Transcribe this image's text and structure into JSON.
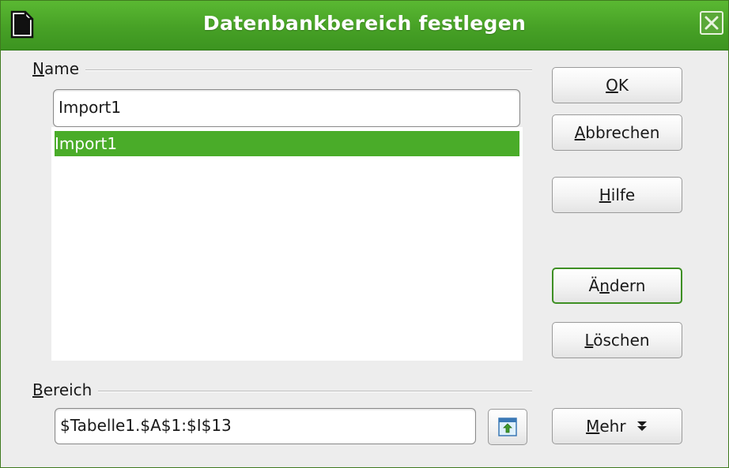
{
  "window": {
    "title": "Datenbankbereich festlegen",
    "accent_color": "#4aac29",
    "icons": {
      "app": "libreoffice-document-icon",
      "close": "close-icon"
    }
  },
  "name_section": {
    "label_mnemonic": "N",
    "label_rest": "ame",
    "input_value": "Import1",
    "list_items": [
      "Import1"
    ],
    "selected_index": 0
  },
  "range_section": {
    "label_mnemonic": "B",
    "label_rest": "ereich",
    "input_value": "$Tabelle1.$A$1:$I$13",
    "shrink_icon": "shrink-dialog-icon"
  },
  "buttons": {
    "ok": {
      "pre": "",
      "mnemonic": "O",
      "post": "K"
    },
    "cancel": {
      "pre": "",
      "mnemonic": "A",
      "post": "bbrechen"
    },
    "help": {
      "pre": "",
      "mnemonic": "H",
      "post": "ilfe"
    },
    "modify": {
      "pre": "Ä",
      "mnemonic": "n",
      "post": "dern"
    },
    "delete": {
      "pre": "",
      "mnemonic": "L",
      "post": "öschen"
    },
    "more": {
      "pre": "",
      "mnemonic": "M",
      "post": "ehr",
      "icon": "double-chevron-down-icon"
    }
  }
}
